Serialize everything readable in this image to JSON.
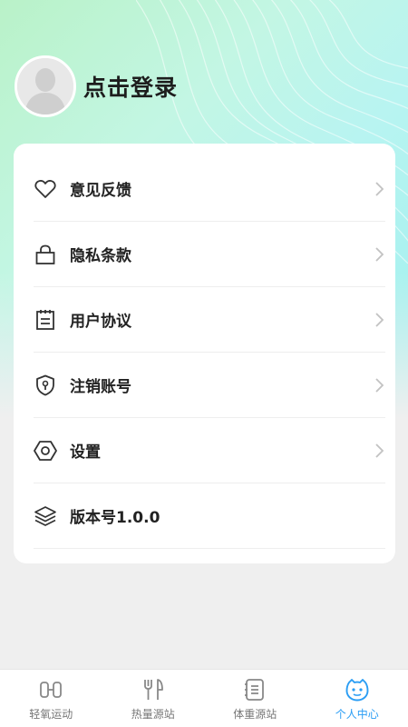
{
  "profile": {
    "login_text": "点击登录"
  },
  "menu": [
    {
      "label": "意见反馈",
      "icon": "heart-icon",
      "has_arrow": true
    },
    {
      "label": "隐私条款",
      "icon": "bag-icon",
      "has_arrow": true
    },
    {
      "label": "用户协议",
      "icon": "clipboard-icon",
      "has_arrow": true
    },
    {
      "label": "注销账号",
      "icon": "shield-icon",
      "has_arrow": true
    },
    {
      "label": "设置",
      "icon": "hexagon-icon",
      "has_arrow": true
    },
    {
      "label": "版本号1.0.0",
      "icon": "layers-icon",
      "has_arrow": false
    }
  ],
  "tabs": [
    {
      "label": "轻氧运动",
      "icon": "exercise-icon",
      "active": false
    },
    {
      "label": "热量源站",
      "icon": "utensils-icon",
      "active": false
    },
    {
      "label": "体重源站",
      "icon": "notebook-icon",
      "active": false
    },
    {
      "label": "个人中心",
      "icon": "smiley-icon",
      "active": true
    }
  ],
  "colors": {
    "accent": "#2a9df4",
    "hero_start": "#b9f2c8",
    "hero_end": "#9ff0ee"
  }
}
